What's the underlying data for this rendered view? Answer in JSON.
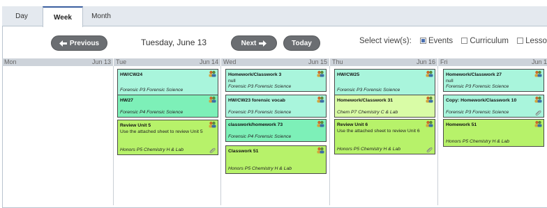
{
  "tabs": [
    {
      "label": "Day"
    },
    {
      "label": "Week"
    },
    {
      "label": "Month"
    }
  ],
  "toolbar": {
    "previous": "Previous",
    "date": "Tuesday, June 13",
    "next": "Next",
    "today": "Today",
    "views_label": "Select view(s):",
    "views": [
      {
        "label": "Events",
        "checked": true
      },
      {
        "label": "Curriculum",
        "checked": false
      },
      {
        "label": "Lessons",
        "checked": false
      }
    ]
  },
  "days": [
    {
      "name": "Mon",
      "date": "Jun 13",
      "events": []
    },
    {
      "name": "Tue",
      "date": "Jun 14",
      "events": [
        {
          "title": "HW/CW24",
          "desc": "",
          "sub": "Forensic P3 Forensic Science",
          "color": "#a9f5dc",
          "clip": false
        },
        {
          "title": "HW27",
          "desc": "",
          "sub": "Forensic P4 Forensic Science",
          "color": "#7df0b8",
          "clip": false
        },
        {
          "title": "Review Unit 5",
          "desc": "Use the attached sheet to review Unit 5",
          "sub": "Honors P5 Chemistry H & Lab",
          "color": "#b7f26a",
          "clip": true
        }
      ]
    },
    {
      "name": "Wed",
      "date": "Jun 15",
      "events": [
        {
          "title": "Homework/Classwork 3",
          "desc": "null",
          "sub": "Forensic P3 Forensic Science",
          "color": "#a9f5dc",
          "clip": false
        },
        {
          "title": "HW/CW23 forensic vocab",
          "desc": "",
          "sub": "Forensic P3 Forensic Science",
          "color": "#a9f5dc",
          "clip": false
        },
        {
          "title": "classwork/homework 73",
          "desc": "",
          "sub": "Forensic P4 Forensic Science",
          "color": "#7df0b8",
          "clip": false
        },
        {
          "title": "Classwork 51",
          "desc": "",
          "sub": "Honors P5 Chemistry H & Lab",
          "color": "#b7f26a",
          "clip": false
        }
      ]
    },
    {
      "name": "Thu",
      "date": "Jun 16",
      "events": [
        {
          "title": "HW/CW25",
          "desc": "",
          "sub": "Forensic P3 Forensic Science",
          "color": "#a9f5dc",
          "clip": false
        },
        {
          "title": "Homework/Classwork 31",
          "desc": "",
          "sub": "Chem P7 Chemistry C & Lab",
          "color": "#d9fca6",
          "clip": false
        },
        {
          "title": "Review Unit 6",
          "desc": "Use the attached sheet to review Unit 6",
          "sub": "Honors P5 Chemistry H & Lab",
          "color": "#b7f26a",
          "clip": true
        }
      ]
    },
    {
      "name": "Fri",
      "date": "Jun 17",
      "events": [
        {
          "title": "Homework/Classwork 27",
          "desc": "null",
          "sub": "Forensic P3 Forensic Science",
          "color": "#a9f5dc",
          "clip": false
        },
        {
          "title": "Copy: Homework/Classwork 10",
          "desc": "",
          "sub": "Forensic P3 Forensic Science",
          "color": "#a9f5dc",
          "clip": true
        },
        {
          "title": "Homework 51",
          "desc": "",
          "sub": "Honors P5 Chemistry H & Lab",
          "color": "#b7f26a",
          "clip": false
        }
      ]
    }
  ]
}
